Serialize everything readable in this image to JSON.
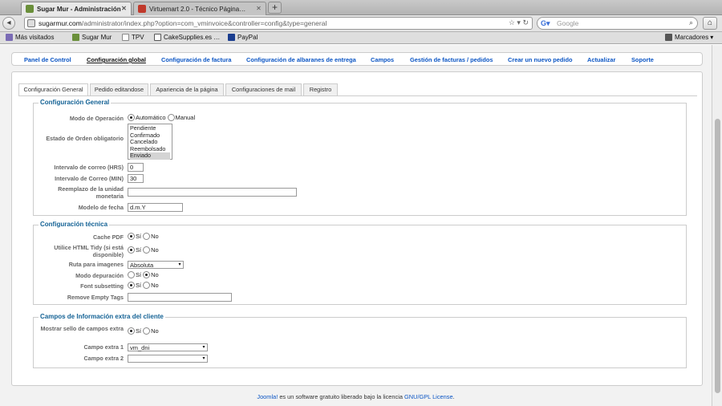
{
  "browser": {
    "tabs": [
      {
        "title": "Sugar Mur - Administración",
        "active": true
      },
      {
        "title": "Virtuemart 2.0 - Técnico Página…",
        "active": false
      }
    ],
    "url_domain": "sugarmur.com",
    "url_path": "/administrator/index.php?option=com_vminvoice&controller=config&type=general",
    "search_placeholder": "Google",
    "bookmarks": [
      "Más visitados",
      "Sugar Mur",
      "TPV",
      "CakeSupplies.es …",
      "PayPal"
    ],
    "bookmarks_menu": "Marcadores"
  },
  "topmenu": [
    "Panel de Control",
    "Configuración global",
    "Configuración de factura",
    "Configuración de albaranes de entrega",
    "Campos",
    "Gestión de facturas / pedidos",
    "Crear un nuevo pedido",
    "Actualizar",
    "Soporte"
  ],
  "tabs": [
    "Configuración General",
    "Pedido editandose",
    "Apariencia de la página",
    "Configuraciones de mail",
    "Registro"
  ],
  "general": {
    "legend": "Configuración General",
    "modo_label": "Modo de Operación",
    "modo_opt1": "Automático",
    "modo_opt2": "Manual",
    "estado_label": "Estado de Orden obligatorio",
    "estado_options": [
      "Pendiente",
      "Confirmado",
      "Cancelado",
      "Reembolsado",
      "Enviado"
    ],
    "estado_selected": "Enviado",
    "hrs_label": "Intervalo de correo (HRS)",
    "hrs_value": "0",
    "min_label": "Intervalo de Correo (MIN)",
    "min_value": "30",
    "reemplazo_label": "Reemplazo de la unidad monetaria",
    "reemplazo_value": "",
    "fecha_label": "Modelo de fecha",
    "fecha_value": "d.m.Y"
  },
  "tecnica": {
    "legend": "Configuración técnica",
    "cache_label": "Cache PDF",
    "tidy_label": "Utilice HTML Tidy (si está disponible)",
    "ruta_label": "Ruta para imagenes",
    "ruta_value": "Absoluta",
    "debug_label": "Modo depuración",
    "font_label": "Font subsetting",
    "remove_label": "Remove Empty Tags",
    "remove_value": "",
    "si": "Sí",
    "no": "No"
  },
  "extra": {
    "legend": "Campos de Información extra del cliente",
    "sello_label": "Mostrar sello de campos extra",
    "campo1_label": "Campo extra 1",
    "campo1_value": "vm_dni",
    "campo2_label": "Campo extra 2",
    "campo2_value": ""
  },
  "footer": {
    "joomla": "Joomla!",
    "middle": " es un software gratuito liberado bajo la licencia ",
    "license": "GNU/GPL License",
    "end": "."
  }
}
